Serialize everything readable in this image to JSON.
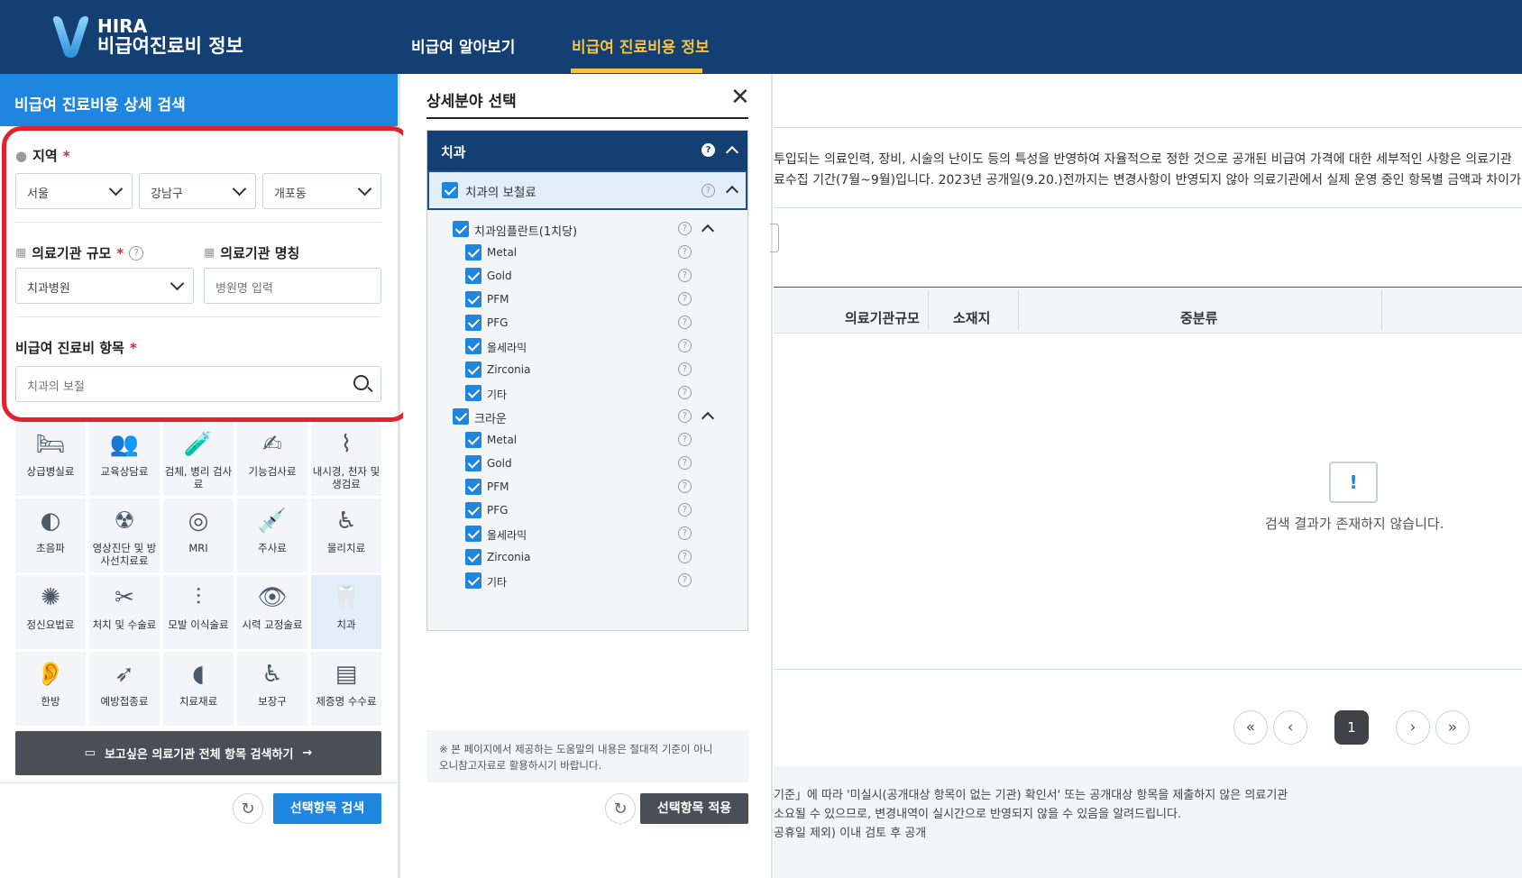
{
  "header": {
    "logo_line1": "HIRA",
    "logo_line2": "비급여진료비 정보",
    "nav": [
      "비급여 알아보기",
      "비급여 진료비용 정보"
    ],
    "active_nav": "비급여 진료비용 정보"
  },
  "left": {
    "title": "비급여 진료비용 상세 검색",
    "region_label": "지역",
    "region": {
      "sido": "서울",
      "sigungu": "강남구",
      "dong": "개포동"
    },
    "scale_label": "의료기관 규모",
    "scale_value": "치과병원",
    "name_label": "의료기관 명칭",
    "name_placeholder": "병원명 입력",
    "item_label": "비급여 진료비 항목",
    "item_value": "치과의 보철",
    "required_mark": "*",
    "help_mark": "?",
    "categories": [
      {
        "label": "상급병실료",
        "icon": "hospital-bed-icon"
      },
      {
        "label": "교육상담료",
        "icon": "consultation-icon"
      },
      {
        "label": "검체, 병리 검사료",
        "icon": "specimen-icon"
      },
      {
        "label": "기능검사료",
        "icon": "function-test-icon"
      },
      {
        "label": "내시경, 천자 및 생검료",
        "icon": "endoscope-icon"
      },
      {
        "label": "초음파",
        "icon": "ultrasound-icon"
      },
      {
        "label": "영상진단 및 방사선치료료",
        "icon": "radiology-icon"
      },
      {
        "label": "MRI",
        "icon": "mri-icon"
      },
      {
        "label": "주사료",
        "icon": "syringe-icon"
      },
      {
        "label": "물리치료",
        "icon": "physical-therapy-icon"
      },
      {
        "label": "정신요법료",
        "icon": "brain-icon"
      },
      {
        "label": "처치 및 수술료",
        "icon": "scalpel-icon"
      },
      {
        "label": "모발 이식술료",
        "icon": "hair-icon"
      },
      {
        "label": "시력 교정술료",
        "icon": "eye-icon"
      },
      {
        "label": "치과",
        "icon": "tooth-icon"
      },
      {
        "label": "한방",
        "icon": "acupuncture-icon"
      },
      {
        "label": "예방접종료",
        "icon": "vaccine-icon"
      },
      {
        "label": "치료재료",
        "icon": "material-icon"
      },
      {
        "label": "보장구",
        "icon": "wheelchair-icon"
      },
      {
        "label": "제증명 수수료",
        "icon": "certificate-icon"
      }
    ],
    "full_search_btn": "보고싶은 의료기관 전체 항목 검색하기",
    "search_btn": "선택항목 검색"
  },
  "mid": {
    "title": "상세분야 선택",
    "tree_head": "치과",
    "level1": "치과의 보철료",
    "group1": {
      "label": "치과임플란트(1치당)",
      "items": [
        "Metal",
        "Gold",
        "PFM",
        "PFG",
        "올세라믹",
        "Zirconia",
        "기타"
      ]
    },
    "group2": {
      "label": "크라운",
      "items": [
        "Metal",
        "Gold",
        "PFM",
        "PFG",
        "올세라믹",
        "Zirconia",
        "기타"
      ]
    },
    "note_line1": "※ 본 페이지에서 제공하는 도움말의 내용은 절대적 기준이 아니",
    "note_line2": "오니참고자료로 활용하시기 바랍니다.",
    "apply_btn": "선택항목 적용"
  },
  "right": {
    "desc1": "투입되는 의료인력, 장비, 시술의 난이도 등의 특성을 반영하여 자율적으로 정한 것으로 공개된 비급여 가격에 대한 세부적인 사항은 의료기관",
    "desc2": "료수집 기간(7월~9월)입니다. 2023년 공개일(9.20.)전까지는 변경사항이 반영되지 않아 의료기관에서 실제 운영 중인 항목별 금액과 차이가",
    "columns": [
      "의료기관규모",
      "소재지",
      "중분류"
    ],
    "empty_msg": "검색 결과가 존재하지 않습니다.",
    "empty_icon": "!",
    "pagination": {
      "current": "1",
      "first": "«",
      "prev": "‹",
      "next": "›",
      "last": "»"
    },
    "foot1": "기준」에 따라 '미실시(공개대상 항목이 없는 기관) 확인서' 또는 공개대상 항목을 제출하지 않은 의료기관",
    "foot2": "소요될 수 있으므로, 변경내역이 실시간으로 반영되지 않을 수 있음을 알려드립니다.",
    "foot3": "공휴일 제외) 이내 검토 후 공개"
  },
  "colors": {
    "navy": "#143f72",
    "blue": "#1f86e0",
    "accent": "#f5c242",
    "highlight": "#e1222a"
  }
}
